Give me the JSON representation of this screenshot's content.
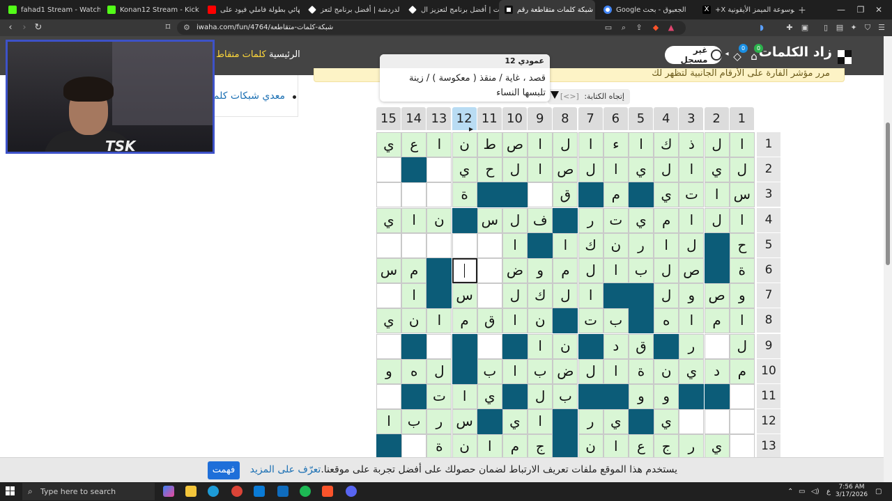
{
  "browser": {
    "tabs": [
      {
        "label": "fahad1 Stream - Watch Live on",
        "icon": "kick-icon",
        "color": "#53fc18"
      },
      {
        "label": "Konan12 Stream - Kick Dashb",
        "icon": "kick-icon",
        "color": "#53fc18"
      },
      {
        "label": "(4) نهائي بطولة فاملي فيود على",
        "icon": "youtube-icon",
        "color": "#ff0000"
      },
      {
        "label": "بوت الدردشة | أفضل برنامج لتعز",
        "icon": "diamond-icon",
        "color": "#ffffff"
      },
      {
        "label": "التنبيهات | أفضل برنامج لتعزيز ال",
        "icon": "diamond-icon",
        "color": "#ffffff"
      },
      {
        "label": "شبكة كلمات متقاطعة رقم",
        "icon": "zad-icon",
        "color": "#ffffff",
        "active": true
      },
      {
        "label": "الجعبوق - بحث Google",
        "icon": "google-icon",
        "color": "#4285f4"
      },
      {
        "label": "(2) موسوعة الميمز الأيقونية X+",
        "icon": "x-icon",
        "color": "#ffffff"
      }
    ],
    "url": "iwaha.com/fun/4764/شبكة-كلمات-متقاطعة"
  },
  "site": {
    "logo": "زاد الكلمات",
    "guest_label": "غير مسجل",
    "badge_cart": "0",
    "badge_gems": "0",
    "nav_home": "الرئيسية",
    "nav_words": "كلمات متقاط"
  },
  "notice": "مرر مؤشر الفارة على الأرقام الجانبية لتظهر لك",
  "sidebar": {
    "link": "معدي شبكات كلم"
  },
  "tooltip": {
    "header": "عمودي 12",
    "clue": "قصد ، غاية / منقذ ( معكوسة ) / زينة تلبسها النساء"
  },
  "direction": {
    "label": "إتجاه الكتابة:",
    "arrows": "[<>]"
  },
  "grid": {
    "cols": [
      "15",
      "14",
      "13",
      "12",
      "11",
      "10",
      "9",
      "8",
      "7",
      "6",
      "5",
      "4",
      "3",
      "2",
      "1"
    ],
    "active_col": "12",
    "rows": [
      "1",
      "2",
      "3",
      "4",
      "5",
      "6",
      "7",
      "8",
      "9",
      "10",
      "11",
      "12",
      "13"
    ],
    "cells": [
      [
        "ي",
        "ع",
        "ا",
        "ن",
        "ط",
        "ص",
        "ا",
        "ل",
        "ا",
        "ء",
        "ا",
        "ك",
        "ذ",
        "ل",
        "ا"
      ],
      [
        "",
        "#",
        "",
        "ي",
        "ح",
        "ل",
        "ا",
        "ص",
        "ل",
        "ا",
        "ي",
        "ل",
        "ا",
        "ي",
        "ل"
      ],
      [
        "",
        "",
        "",
        "ة",
        "#",
        "#",
        "",
        "ق",
        "#",
        "م",
        "#",
        "ي",
        "ت",
        "ا",
        "س"
      ],
      [
        "ي",
        "ا",
        "ن",
        "#",
        "س",
        "ل",
        "ف",
        "#",
        "ر",
        "ت",
        "ي",
        "م",
        "ا",
        "ل",
        "ا"
      ],
      [
        "",
        "",
        "",
        "",
        "",
        "ا",
        "#",
        "ا",
        "ك",
        "ن",
        "ر",
        "ا",
        "ل",
        "#",
        "ح"
      ],
      [
        "س",
        "م",
        "#",
        "*",
        "",
        "ض",
        "و",
        "م",
        "ل",
        "ا",
        "ب",
        "ل",
        "ص",
        "#",
        "ة"
      ],
      [
        "",
        "ا",
        "#",
        "س",
        "",
        "ل",
        "ك",
        "ل",
        "ا",
        "#",
        "#",
        "ل",
        "و",
        "ص",
        "و"
      ],
      [
        "ي",
        "ن",
        "ا",
        "م",
        "ق",
        "ا",
        "ن",
        "#",
        "ت",
        "ب",
        "#",
        "ه",
        "ا",
        "م",
        "ا"
      ],
      [
        "",
        "#",
        "",
        "#",
        "",
        "#",
        "ا",
        "ن",
        "#",
        "د",
        "ق",
        "#",
        "ر",
        "",
        "ل"
      ],
      [
        "و",
        "ه",
        "ل",
        "#",
        "ب",
        "ا",
        "ب",
        "ض",
        "ل",
        "ا",
        "ة",
        "ن",
        "ي",
        "د",
        "م"
      ],
      [
        "",
        "#",
        "ت",
        "ا",
        "ي",
        "#",
        "ل",
        "ب",
        "#",
        "#",
        "و",
        "و",
        "#",
        "#",
        ""
      ],
      [
        "ا",
        "ب",
        "ر",
        "س",
        "#",
        "ي",
        "ا",
        "#",
        "ر",
        "ي",
        "#",
        "ي",
        "",
        "",
        ""
      ],
      [
        "#",
        "",
        "ة",
        "ن",
        "ا",
        "م",
        "ج",
        "#",
        "ن",
        "ا",
        "ع",
        "ج",
        "ر",
        "ي",
        ""
      ]
    ]
  },
  "cookie": {
    "text": "يستخدم هذا الموقع ملفات تعريف الارتباط لضمان حصولك على أفضل تجربة على موقعنا.",
    "more": "تعرّف على المزيد",
    "ok": "فهمت"
  },
  "taskbar": {
    "search_placeholder": "Type here to search",
    "time": "7:56 AM",
    "date": "3/17/2026",
    "lang": "ع"
  },
  "colors": {
    "letter_cell": "#d9f6d5",
    "block_cell": "#0c5c78",
    "header_bg": "#444444",
    "accent_yellow": "#ffd83a"
  }
}
